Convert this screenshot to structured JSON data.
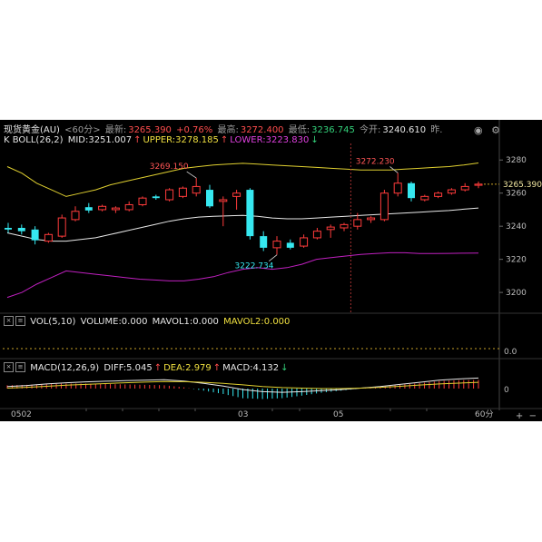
{
  "quote": {
    "symbol": "现货黄金(AU)",
    "period": "<60分>",
    "latest_label": "最新:",
    "latest": "3265.390",
    "change": "+0.76%",
    "high_label": "最高:",
    "high": "3272.400",
    "low_label": "最低:",
    "low": "3236.745",
    "open_label": "今开:",
    "open": "3240.610",
    "prev_label": "昨."
  },
  "boll": {
    "label": "K BOLL(26,2)",
    "mid": "MID:3251.007",
    "upper": "UPPER:3278.185",
    "lower": "LOWER:3223.830",
    "arrow_up": "↑",
    "arrow_down": "↓"
  },
  "vol": {
    "label": "VOL(5,10)",
    "volume": "VOLUME:0.000",
    "mavol1": "MAVOL1:0.000",
    "mavol2": "MAVOL2:0.000",
    "axis_tick": "0.0"
  },
  "macd": {
    "label": "MACD(12,26,9)",
    "diff": "DIFF:5.045",
    "dea": "DEA:2.979",
    "macd": "MACD:4.132",
    "arrow_up": "↑",
    "arrow_down": "↓",
    "axis_tick": "0"
  },
  "price_axis": {
    "ticks": [
      "3280",
      "3260",
      "3240",
      "3220",
      "3200"
    ],
    "current_tag": "3265.390"
  },
  "annotations": {
    "high1": "3269.150",
    "high2": "3272.230",
    "low1": "3222.734"
  },
  "time_axis": {
    "labels": [
      "0502",
      "03",
      "05"
    ],
    "period_button": "60分"
  },
  "icons": {
    "eye": "eye-icon",
    "settings": "settings-icon",
    "plus": "plus-icon",
    "minus": "minus-icon"
  },
  "colors": {
    "up": "#ff3b3b",
    "down": "#36e8f0",
    "boll_mid": "#e8e8e8",
    "boll_upper": "#e0d030",
    "boll_lower": "#c020c0",
    "background": "#000000",
    "grid": "#3a0000"
  },
  "chart_data": {
    "type": "candlestick",
    "price_range": [
      3188,
      3290
    ],
    "candles": [
      {
        "o": 3239.0,
        "h": 3242.0,
        "l": 3236.0,
        "c": 3238.0
      },
      {
        "o": 3239.0,
        "h": 3241.0,
        "l": 3235.0,
        "c": 3237.0
      },
      {
        "o": 3238.0,
        "h": 3240.0,
        "l": 3229.0,
        "c": 3231.5
      },
      {
        "o": 3231.0,
        "h": 3236.0,
        "l": 3230.0,
        "c": 3235.0
      },
      {
        "o": 3234.0,
        "h": 3247.0,
        "l": 3233.0,
        "c": 3245.0
      },
      {
        "o": 3244.0,
        "h": 3252.0,
        "l": 3243.0,
        "c": 3249.0
      },
      {
        "o": 3251.5,
        "h": 3254.0,
        "l": 3248.0,
        "c": 3249.5
      },
      {
        "o": 3250.0,
        "h": 3253.0,
        "l": 3249.0,
        "c": 3252.0
      },
      {
        "o": 3250.0,
        "h": 3252.0,
        "l": 3248.0,
        "c": 3251.0
      },
      {
        "o": 3250.0,
        "h": 3255.0,
        "l": 3249.0,
        "c": 3253.0
      },
      {
        "o": 3253.0,
        "h": 3258.0,
        "l": 3252.0,
        "c": 3257.0
      },
      {
        "o": 3258.0,
        "h": 3259.0,
        "l": 3256.0,
        "c": 3257.0
      },
      {
        "o": 3256.0,
        "h": 3263.0,
        "l": 3255.0,
        "c": 3262.0
      },
      {
        "o": 3258.0,
        "h": 3264.0,
        "l": 3257.0,
        "c": 3263.0
      },
      {
        "o": 3260.0,
        "h": 3269.15,
        "l": 3258.0,
        "c": 3264.0
      },
      {
        "o": 3262.0,
        "h": 3265.0,
        "l": 3251.0,
        "c": 3252.0
      },
      {
        "o": 3255.0,
        "h": 3258.0,
        "l": 3240.0,
        "c": 3256.0
      },
      {
        "o": 3258.0,
        "h": 3262.0,
        "l": 3250.0,
        "c": 3260.0
      },
      {
        "o": 3262.0,
        "h": 3263.0,
        "l": 3232.0,
        "c": 3234.0
      },
      {
        "o": 3234.0,
        "h": 3237.0,
        "l": 3225.0,
        "c": 3227.0
      },
      {
        "o": 3227.0,
        "h": 3234.0,
        "l": 3222.734,
        "c": 3231.0
      },
      {
        "o": 3230.0,
        "h": 3232.0,
        "l": 3226.0,
        "c": 3227.0
      },
      {
        "o": 3228.0,
        "h": 3235.0,
        "l": 3227.0,
        "c": 3233.0
      },
      {
        "o": 3233.0,
        "h": 3239.0,
        "l": 3232.0,
        "c": 3237.0
      },
      {
        "o": 3238.0,
        "h": 3241.0,
        "l": 3233.0,
        "c": 3239.5
      },
      {
        "o": 3239.0,
        "h": 3242.0,
        "l": 3237.0,
        "c": 3241.0
      },
      {
        "o": 3240.0,
        "h": 3248.0,
        "l": 3238.0,
        "c": 3244.0
      },
      {
        "o": 3244.0,
        "h": 3246.0,
        "l": 3242.0,
        "c": 3245.0
      },
      {
        "o": 3244.0,
        "h": 3262.0,
        "l": 3243.0,
        "c": 3260.0
      },
      {
        "o": 3260.0,
        "h": 3272.23,
        "l": 3258.0,
        "c": 3266.0
      },
      {
        "o": 3266.0,
        "h": 3267.0,
        "l": 3255.0,
        "c": 3257.0
      },
      {
        "o": 3256.0,
        "h": 3259.0,
        "l": 3255.0,
        "c": 3258.0
      },
      {
        "o": 3258.0,
        "h": 3261.0,
        "l": 3257.0,
        "c": 3260.0
      },
      {
        "o": 3260.0,
        "h": 3263.0,
        "l": 3259.0,
        "c": 3262.0
      },
      {
        "o": 3262.0,
        "h": 3266.0,
        "l": 3261.0,
        "c": 3264.0
      },
      {
        "o": 3265.0,
        "h": 3267.0,
        "l": 3263.0,
        "c": 3265.39
      }
    ],
    "boll_upper": [
      3276,
      3272,
      3266,
      3262,
      3258,
      3260,
      3262,
      3265,
      3267,
      3269,
      3271,
      3273,
      3275,
      3276,
      3277,
      3277.5,
      3278,
      3277.5,
      3277,
      3276.5,
      3276,
      3275.5,
      3275,
      3274.5,
      3274,
      3274,
      3274,
      3274.5,
      3275,
      3275.5,
      3276,
      3277,
      3278.185
    ],
    "boll_mid": [
      3236,
      3234,
      3232,
      3231,
      3231,
      3232,
      3233,
      3235,
      3237,
      3239,
      3241,
      3243,
      3244.5,
      3245.5,
      3246,
      3246.3,
      3246.5,
      3246,
      3245,
      3244.5,
      3244.5,
      3245,
      3245.5,
      3246,
      3246.5,
      3247,
      3247.5,
      3248,
      3248.5,
      3249,
      3249.5,
      3250.3,
      3251.007
    ],
    "boll_lower": [
      3197,
      3200,
      3205,
      3209,
      3213,
      3212,
      3211,
      3210,
      3209,
      3208,
      3207.5,
      3207,
      3207,
      3208,
      3209.5,
      3212,
      3214,
      3215,
      3214,
      3215,
      3217,
      3220,
      3221,
      3222,
      3223,
      3223.5,
      3224,
      3224,
      3223.5,
      3223.5,
      3223.6,
      3223.7,
      3223.83
    ],
    "macd_diff": [
      1.0,
      1.5,
      2.2,
      2.8,
      3.2,
      3.5,
      3.8,
      4.0,
      4.2,
      3.6,
      2.5,
      1.2,
      -0.5,
      -1.5,
      -1.8,
      -1.5,
      -1.0,
      -0.5,
      0.2,
      1.0,
      2.0,
      3.0,
      4.0,
      4.6,
      5.045
    ],
    "macd_dea": [
      0.2,
      0.6,
      1.1,
      1.6,
      2.0,
      2.4,
      2.8,
      3.1,
      3.4,
      3.3,
      3.0,
      2.5,
      1.8,
      1.0,
      0.5,
      0.2,
      0.0,
      0.0,
      0.2,
      0.6,
      1.1,
      1.7,
      2.2,
      2.6,
      2.979
    ],
    "macd_bar": [
      1.6,
      1.8,
      2.2,
      2.4,
      2.4,
      2.2,
      2.0,
      1.8,
      1.6,
      0.6,
      -1.0,
      -2.6,
      -4.6,
      -5.0,
      -4.6,
      -3.4,
      -2.0,
      -1.0,
      0.0,
      0.8,
      1.8,
      2.6,
      3.6,
      4.0,
      4.132
    ],
    "vertical_marker_after_candle": 26
  }
}
